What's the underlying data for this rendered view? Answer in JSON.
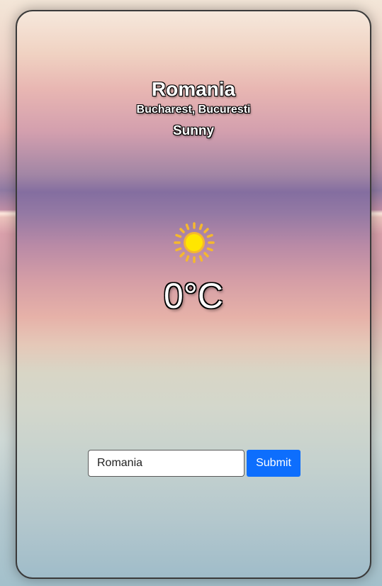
{
  "weather": {
    "country": "Romania",
    "location": "Bucharest, Bucuresti",
    "condition": "Sunny",
    "icon": "sun-icon",
    "temperature": "0°C"
  },
  "search": {
    "value": "Romania",
    "submit_label": "Submit"
  },
  "colors": {
    "accent": "#0d6efd",
    "sun_core": "#ffd700",
    "sun_rays": "#f5b82e"
  }
}
